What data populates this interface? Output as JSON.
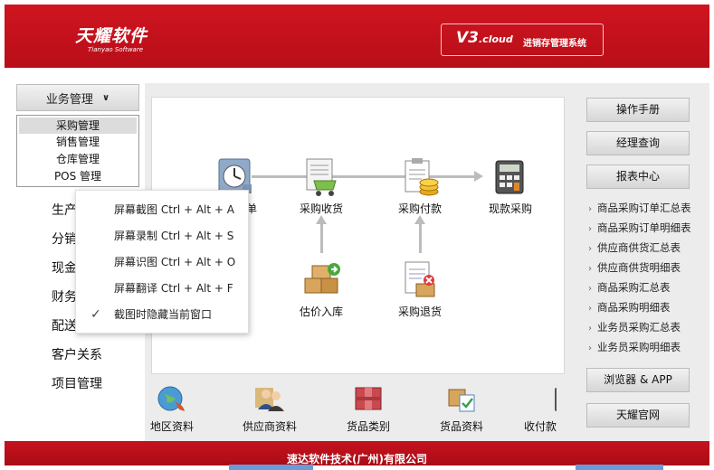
{
  "header": {
    "logo_cn": "天耀软件",
    "logo_en": "Tianyao Software",
    "version": "V3",
    "version_suffix": ".cloud",
    "system_name": "进销存管理系统"
  },
  "left_panel": {
    "module_button": "业务管理",
    "sub_items": [
      "采购管理",
      "销售管理",
      "仓库管理",
      "POS 管理"
    ],
    "categories": [
      "生产管理",
      "分销管理",
      "现金银行",
      "财务管理",
      "配送中心",
      "客户关系",
      "项目管理"
    ]
  },
  "flow": {
    "nodes": [
      "采购订单",
      "采购收货",
      "采购付款",
      "现款采购",
      "估价入库",
      "采购退货"
    ]
  },
  "bottom_row": [
    "地区资料",
    "供应商资料",
    "货品类别",
    "货品资料",
    "收付款"
  ],
  "right_panel": {
    "buttons": [
      "操作手册",
      "经理查询",
      "报表中心"
    ],
    "links": [
      "商品采购订单汇总表",
      "商品采购订单明细表",
      "供应商供货汇总表",
      "供应商供货明细表",
      "商品采购汇总表",
      "商品采购明细表",
      "业务员采购汇总表",
      "业务员采购明细表"
    ],
    "bottom_buttons": [
      "浏览器 & APP",
      "天耀官网"
    ]
  },
  "context_menu": {
    "items": [
      "屏幕截图 Ctrl + Alt + A",
      "屏幕录制 Ctrl + Alt + S",
      "屏幕识图 Ctrl + Alt + O",
      "屏幕翻译 Ctrl + Alt + F",
      "截图时隐藏当前窗口"
    ],
    "checked_index": 4
  },
  "footer": {
    "company": "速达软件技术(广州)有限公司"
  },
  "colors": {
    "brand_red": "#c4101c",
    "panel_gray": "#ececec",
    "flow_arrow": "#bcbcbc"
  }
}
